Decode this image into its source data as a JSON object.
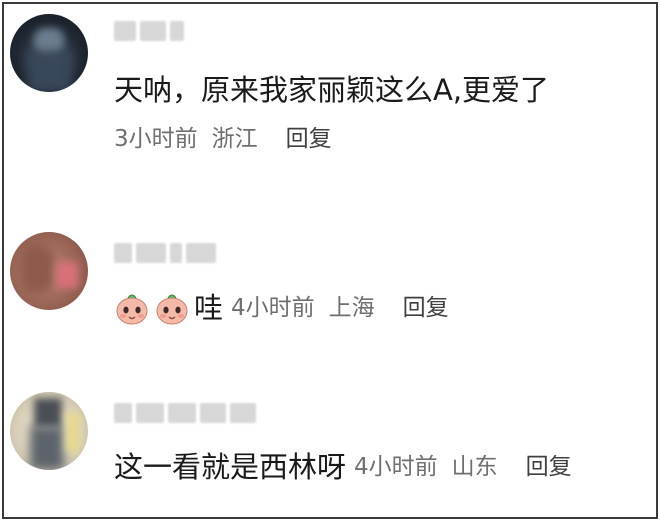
{
  "comments": [
    {
      "text": "天呐，原来我家丽颖这么A,更爱了",
      "time": "3小时前",
      "location": "浙江",
      "reply": "回复"
    },
    {
      "text": "哇",
      "time": "4小时前",
      "location": "上海",
      "reply": "回复",
      "emojis": [
        "peach-face-emoji",
        "peach-face-emoji"
      ]
    },
    {
      "text": "这一看就是西林呀",
      "time": "4小时前",
      "location": "山东",
      "reply": "回复"
    }
  ],
  "colors": {
    "text": "#1a1a1a",
    "meta": "#6f6f6f",
    "border": "#3a3a3a"
  }
}
